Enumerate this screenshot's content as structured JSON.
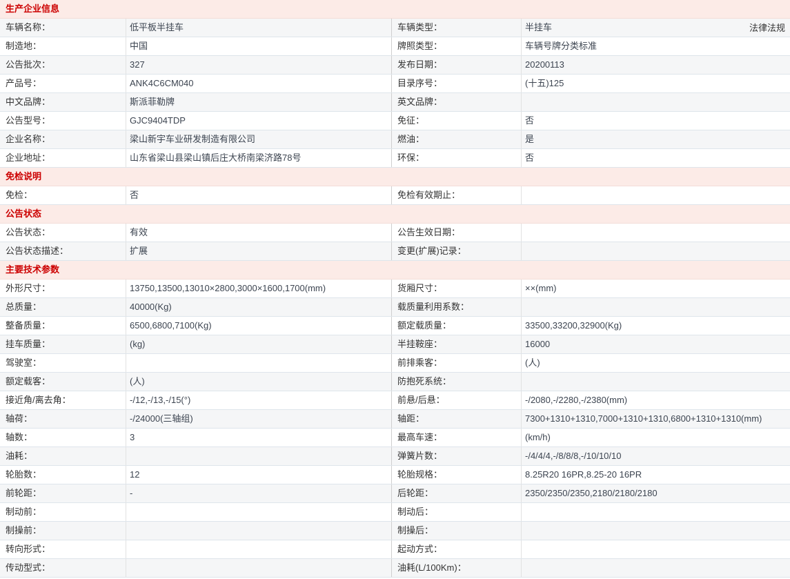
{
  "legal_link": "法律法规",
  "colors": {
    "section_header_bg": "#fcebe7",
    "section_header_text": "#cc0000",
    "alt_row_bg": "#f5f6f7",
    "row_border": "#dee5eb"
  },
  "sections": [
    {
      "title": "生产企业信息",
      "stripe_offset": 1,
      "rows": [
        {
          "label1": "车辆名称：",
          "value1": "低平板半挂车",
          "label2": "车辆类型：",
          "value2": "半挂车"
        },
        {
          "label1": "制造地：",
          "value1": "中国",
          "label2": "牌照类型：",
          "value2": "车辆号牌分类标准"
        },
        {
          "label1": "公告批次：",
          "value1": "327",
          "label2": "发布日期：",
          "value2": "20200113"
        },
        {
          "label1": "产品号：",
          "value1": "ANK4C6CM040",
          "label2": "目录序号：",
          "value2": "(十五)125"
        },
        {
          "label1": "中文品牌：",
          "value1": "斯派菲勒牌",
          "label2": "英文品牌：",
          "value2": ""
        },
        {
          "label1": "公告型号：",
          "value1": "GJC9404TDP",
          "label2": "免征：",
          "value2": "否"
        },
        {
          "label1": "企业名称：",
          "value1": "梁山新宇车业研发制造有限公司",
          "label2": "燃油：",
          "value2": "是"
        },
        {
          "label1": "企业地址：",
          "value1": "山东省梁山县梁山镇后庄大桥南梁济路78号",
          "label2": "环保：",
          "value2": "否"
        }
      ]
    },
    {
      "title": "免检说明",
      "stripe_offset": 0,
      "rows": [
        {
          "label1": "免检：",
          "value1": "否",
          "label2": "免检有效期止：",
          "value2": ""
        }
      ]
    },
    {
      "title": "公告状态",
      "stripe_offset": 0,
      "rows": [
        {
          "label1": "公告状态：",
          "value1": "有效",
          "label2": "公告生效日期：",
          "value2": ""
        },
        {
          "label1": "公告状态描述：",
          "value1": "扩展",
          "label2": "变更(扩展)记录：",
          "value2": ""
        }
      ]
    },
    {
      "title": "主要技术参数",
      "stripe_offset": 0,
      "rows": [
        {
          "label1": "外形尺寸：",
          "value1": "13750,13500,13010×2800,3000×1600,1700(mm)",
          "label2": "货厢尺寸：",
          "value2": "××(mm)"
        },
        {
          "label1": "总质量：",
          "value1": "40000(Kg)",
          "label2": "载质量利用系数：",
          "value2": ""
        },
        {
          "label1": "整备质量：",
          "value1": "6500,6800,7100(Kg)",
          "label2": "额定载质量：",
          "value2": "33500,33200,32900(Kg)"
        },
        {
          "label1": "挂车质量：",
          "value1": "(kg)",
          "label2": "半挂鞍座：",
          "value2": "16000"
        },
        {
          "label1": "驾驶室：",
          "value1": "",
          "label2": "前排乘客：",
          "value2": "(人)"
        },
        {
          "label1": "额定载客：",
          "value1": "(人)",
          "label2": "防抱死系统：",
          "value2": ""
        },
        {
          "label1": "接近角/离去角：",
          "value1": "-/12,-/13,-/15(°)",
          "label2": "前悬/后悬：",
          "value2": "-/2080,-/2280,-/2380(mm)"
        },
        {
          "label1": "轴荷：",
          "value1": "-/24000(三轴组)",
          "label2": "轴距：",
          "value2": "7300+1310+1310,7000+1310+1310,6800+1310+1310(mm)"
        },
        {
          "label1": "轴数：",
          "value1": "3",
          "label2": "最高车速：",
          "value2": "(km/h)"
        },
        {
          "label1": "油耗：",
          "value1": "",
          "label2": "弹簧片数：",
          "value2": "-/4/4/4,-/8/8/8,-/10/10/10"
        },
        {
          "label1": "轮胎数：",
          "value1": "12",
          "label2": "轮胎规格：",
          "value2": "8.25R20 16PR,8.25-20 16PR"
        },
        {
          "label1": "前轮距：",
          "value1": "-",
          "label2": "后轮距：",
          "value2": "2350/2350/2350,2180/2180/2180"
        },
        {
          "label1": "制动前：",
          "value1": "",
          "label2": "制动后：",
          "value2": ""
        },
        {
          "label1": "制操前：",
          "value1": "",
          "label2": "制操后：",
          "value2": ""
        },
        {
          "label1": "转向形式：",
          "value1": "",
          "label2": "起动方式：",
          "value2": ""
        },
        {
          "label1": "传动型式：",
          "value1": "",
          "label2": "油耗(L/100Km)：",
          "value2": ""
        }
      ]
    }
  ]
}
